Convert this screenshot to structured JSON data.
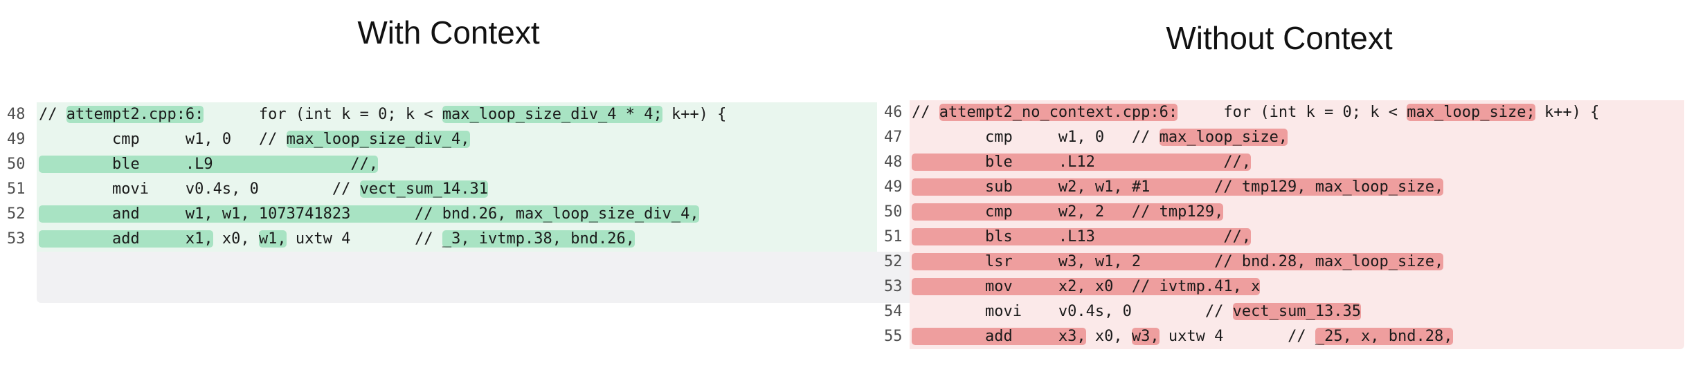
{
  "titles": {
    "left": "With Context",
    "right": "Without Context"
  },
  "left_panel": {
    "rows": [
      {
        "line": "48",
        "segments": [
          {
            "text": "// ",
            "hl": false
          },
          {
            "text": "attempt2.cpp:6:",
            "hl": true
          },
          {
            "text": "      for (int k = 0; k < ",
            "hl": false
          },
          {
            "text": "max_loop_size_div_4 * 4;",
            "hl": true
          },
          {
            "text": " k++) {",
            "hl": false
          }
        ]
      },
      {
        "line": "49",
        "segments": [
          {
            "text": "        cmp     w1, 0   // ",
            "hl": false
          },
          {
            "text": "max_loop_size_div_4,",
            "hl": true
          }
        ]
      },
      {
        "line": "50",
        "segments": [
          {
            "text": "        ble     .L9               //,",
            "hl": true
          }
        ]
      },
      {
        "line": "51",
        "segments": [
          {
            "text": "        movi    v0.4s, 0        // ",
            "hl": false
          },
          {
            "text": "vect_sum_14.31",
            "hl": true
          }
        ]
      },
      {
        "line": "52",
        "segments": [
          {
            "text": "        and     w1, w1, 1073741823       // bnd.26, max_loop_size_div_4,",
            "hl": true
          }
        ]
      },
      {
        "line": "53",
        "segments": [
          {
            "text": "        add     x1,",
            "hl": true
          },
          {
            "text": " x0, ",
            "hl": false
          },
          {
            "text": "w1,",
            "hl": true
          },
          {
            "text": " uxtw 4       // ",
            "hl": false
          },
          {
            "text": "_3, ivtmp.38, bnd.26,",
            "hl": true
          }
        ]
      }
    ]
  },
  "right_panel": {
    "rows": [
      {
        "line": "46",
        "segments": [
          {
            "text": "// ",
            "hl": false
          },
          {
            "text": "attempt2_no_context.cpp:6:",
            "hl": true
          },
          {
            "text": "     for (int k = 0; k < ",
            "hl": false
          },
          {
            "text": "max_loop_size;",
            "hl": true
          },
          {
            "text": " k++) {",
            "hl": false
          }
        ]
      },
      {
        "line": "47",
        "segments": [
          {
            "text": "        cmp     w1, 0   // ",
            "hl": false
          },
          {
            "text": "max_loop_size,",
            "hl": true
          }
        ]
      },
      {
        "line": "48",
        "segments": [
          {
            "text": "        ble     .L12              //,",
            "hl": true
          }
        ]
      },
      {
        "line": "49",
        "segments": [
          {
            "text": "        sub     w2, w1, #1       // tmp129, max_loop_size,",
            "hl": true
          }
        ]
      },
      {
        "line": "50",
        "segments": [
          {
            "text": "        cmp     w2, 2   // tmp129,",
            "hl": true
          }
        ]
      },
      {
        "line": "51",
        "segments": [
          {
            "text": "        bls     .L13              //,",
            "hl": true
          }
        ]
      },
      {
        "line": "52",
        "segments": [
          {
            "text": "        lsr     w3, w1, 2        // bnd.28, max_loop_size,",
            "hl": true
          }
        ]
      },
      {
        "line": "53",
        "segments": [
          {
            "text": "        mov     x2, x0  // ivtmp.41, x",
            "hl": true
          }
        ]
      },
      {
        "line": "54",
        "segments": [
          {
            "text": "        movi    v0.4s, 0        // ",
            "hl": false
          },
          {
            "text": "vect_sum_13.35",
            "hl": true
          }
        ]
      },
      {
        "line": "55",
        "segments": [
          {
            "text": "        add     x3,",
            "hl": true
          },
          {
            "text": " x0, ",
            "hl": false
          },
          {
            "text": "w3,",
            "hl": true
          },
          {
            "text": " uxtw 4       // ",
            "hl": false
          },
          {
            "text": "_25, x, bnd.28,",
            "hl": true
          }
        ]
      }
    ]
  },
  "colors": {
    "left_bg": "#e9f6ee",
    "left_highlight": "#a8e3c3",
    "right_bg": "#fbe9e9",
    "right_highlight": "#ee9e9e",
    "empty_area": "#f1f1f3"
  }
}
